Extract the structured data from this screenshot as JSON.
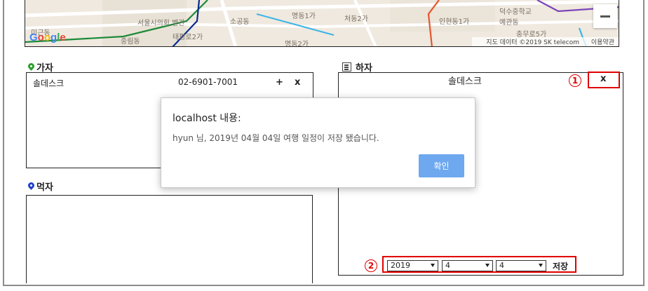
{
  "map": {
    "labels": [
      "서울시의회 별관",
      "소공동",
      "명동1가",
      "처동2가",
      "인현동1가",
      "덕수중학교",
      "예관동",
      "충무로5가",
      "태평로2가",
      "명동2가",
      "미근동",
      "중림동"
    ],
    "copyright": "지도 데이터 ©2019 SK telecom",
    "terms_link": "이용약관",
    "google_logo": "Google"
  },
  "sections": {
    "gaja_title": "가자",
    "hacha_title": "하자",
    "meokja_title": "먹자"
  },
  "gaja": {
    "item_name": "솔데스크",
    "item_phone": "02-6901-7001",
    "add_label": "+",
    "remove_label": "x"
  },
  "hacha": {
    "item_name": "솔데스크",
    "remove_label": "x",
    "year": "2019",
    "month": "4",
    "day": "4",
    "save_label": "저장"
  },
  "dialog": {
    "title": "localhost 내용:",
    "message": "hyun 님, 2019년 04월 04일 여행 일정이 저장 됐습니다.",
    "ok_label": "확인"
  },
  "annotations": {
    "badge_1": "1",
    "badge_2": "2"
  },
  "colors": {
    "highlight": "#e00000",
    "dialog_button": "#6ea8ef",
    "gaja_pin": "#2aa02a",
    "meokja_pin": "#2040d0"
  }
}
